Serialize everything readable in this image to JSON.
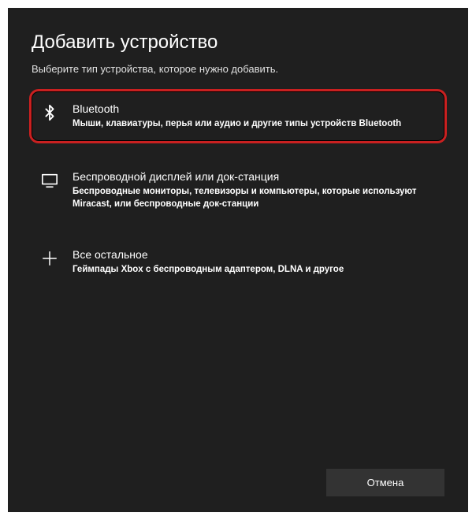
{
  "dialog": {
    "title": "Добавить устройство",
    "subtitle": "Выберите тип устройства, которое нужно добавить."
  },
  "options": {
    "bluetooth": {
      "title": "Bluetooth",
      "desc": "Мыши, клавиатуры, перья или аудио и другие типы устройств Bluetooth"
    },
    "display": {
      "title": "Беспроводной дисплей или док-станция",
      "desc": "Беспроводные мониторы, телевизоры и компьютеры, которые используют Miracast, или беспроводные док-станции"
    },
    "other": {
      "title": "Все остальное",
      "desc": "Геймпады Xbox с беспроводным адаптером, DLNA и другое"
    }
  },
  "buttons": {
    "cancel": "Отмена"
  }
}
